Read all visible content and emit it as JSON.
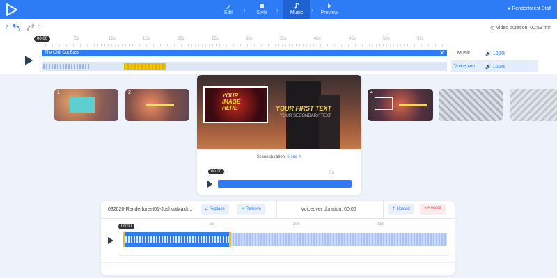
{
  "nav": {
    "steps": [
      {
        "label": "Edit",
        "icon": "pencil-icon"
      },
      {
        "label": "Style",
        "icon": "palette-icon"
      },
      {
        "label": "Music",
        "icon": "music-note-icon"
      },
      {
        "label": "Preview",
        "icon": "play-icon"
      }
    ],
    "active_step": "Music",
    "user": "Renderforest Staff"
  },
  "toolbar": {
    "undo_count": "7",
    "redo_count": "0",
    "video_duration": "Video duration: 00:59 min"
  },
  "timeline": {
    "current_time": "00:00",
    "ticks": [
      "5s",
      "10s",
      "15s",
      "20s",
      "25s",
      "30s",
      "35s",
      "40s",
      "45s",
      "50s",
      "55s"
    ],
    "music_track": {
      "title": "The Chill Out Bass",
      "name": "Music",
      "volume": "100%"
    },
    "voiceover_track": {
      "name": "Voiceover",
      "volume": "100%"
    }
  },
  "scenes": [
    {
      "number": "1"
    },
    {
      "number": "2"
    },
    {
      "number": "4"
    }
  ],
  "preview": {
    "image_text": "YOUR IMAGE HERE",
    "first_text": "YOUR FIRST TEXT",
    "second_text": "YOUR SECONDARY TEXT",
    "scene_duration_label": "Scene duration:",
    "scene_duration_value": "6 sec",
    "current_time": "00:00",
    "tick": "5s"
  },
  "voiceover_editor": {
    "file_name": "032020-Renderforest01-JoshuaMack...",
    "replace_label": "Replace",
    "remove_label": "Remove",
    "duration": "Voiceover duration: 00:06",
    "upload_label": "Upload",
    "record_label": "Record",
    "current_time": "00:00",
    "ticks": [
      "5s",
      "10s",
      "15s"
    ]
  },
  "colors": {
    "accent": "#2d7cf6",
    "selection": "#f5c400",
    "record": "#e44a4a"
  }
}
